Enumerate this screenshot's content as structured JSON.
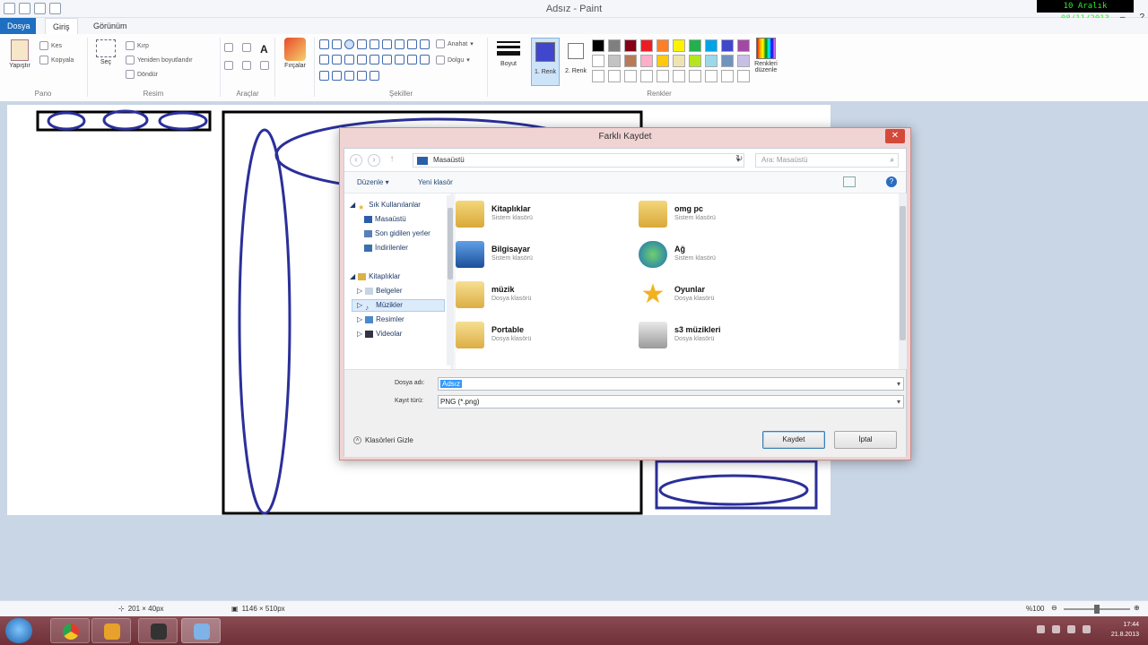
{
  "window": {
    "title": "Adsız - Paint",
    "overlay_datetime": "10 Aralık 08/11/2013"
  },
  "tabs": {
    "file": "Dosya",
    "home": "Giriş",
    "view": "Görünüm"
  },
  "ribbon": {
    "clipboard": {
      "paste": "Yapıştır",
      "cut": "Kes",
      "copy": "Kopyala",
      "label": "Pano"
    },
    "image": {
      "select": "Seç",
      "crop": "Kırp",
      "resize": "Yeniden boyutlandır",
      "rotate": "Döndür",
      "label": "Resim"
    },
    "tools": {
      "label": "Araçlar"
    },
    "brushes": {
      "label": "Fırçalar"
    },
    "shapes": {
      "outline": "Anahat",
      "fill": "Dolgu",
      "label": "Şekiller"
    },
    "size": {
      "label": "Boyut"
    },
    "color1": {
      "label": "1. Renk"
    },
    "color2": {
      "label": "2. Renk"
    },
    "colors": {
      "edit": "Renkleri düzenle",
      "label": "Renkler"
    }
  },
  "palette": [
    "#000000",
    "#7f7f7f",
    "#880015",
    "#ed1c24",
    "#ff7f27",
    "#fff200",
    "#22b14c",
    "#00a2e8",
    "#3f48cc",
    "#a349a4",
    "#ffffff",
    "#c3c3c3",
    "#b97a57",
    "#ffaec9",
    "#ffc90e",
    "#efe4b0",
    "#b5e61d",
    "#99d9ea",
    "#7092be",
    "#c8bfe7",
    "#ffffff",
    "#ffffff",
    "#ffffff",
    "#ffffff",
    "#ffffff",
    "#ffffff",
    "#ffffff",
    "#ffffff",
    "#ffffff",
    "#ffffff"
  ],
  "colors": {
    "color1": "#3f48cc",
    "color2": "#ffffff",
    "accent": "#1e6fc2"
  },
  "dialog": {
    "title": "Farklı Kaydet",
    "address": "Masaüstü",
    "search_placeholder": "Ara: Masaüstü",
    "toolbar": {
      "organize": "Düzenle ▾",
      "new_folder": "Yeni klasör"
    },
    "tree": {
      "favorites": "Sık Kullanılanlar",
      "desktop": "Masaüstü",
      "recent": "Son gidilen yerler",
      "downloads": "İndirilenler",
      "libraries": "Kitaplıklar",
      "documents": "Belgeler",
      "music": "Müzikler",
      "pictures": "Resimler",
      "videos": "Videolar"
    },
    "files": [
      {
        "name": "Kitaplıklar",
        "type": "Sistem klasörü",
        "icon": "libraries-icon"
      },
      {
        "name": "omg pc",
        "type": "Sistem klasörü",
        "icon": "user-folder-icon"
      },
      {
        "name": "Bilgisayar",
        "type": "Sistem klasörü",
        "icon": "computer-icon"
      },
      {
        "name": "Ağ",
        "type": "Sistem klasörü",
        "icon": "network-icon"
      },
      {
        "name": "müzik",
        "type": "Dosya klasörü",
        "icon": "folder-icon"
      },
      {
        "name": "Oyunlar",
        "type": "Dosya klasörü",
        "icon": "star-icon"
      },
      {
        "name": "Portable",
        "type": "Dosya klasörü",
        "icon": "folder-icon"
      },
      {
        "name": "s3 müzikleri",
        "type": "Dosya klasörü",
        "icon": "document-folder-icon"
      }
    ],
    "filename_label": "Dosya adı:",
    "filename_value": "Adsız",
    "filetype_label": "Kayıt türü:",
    "filetype_value": "PNG (*.png)",
    "hide_folders": "Klasörleri Gizle",
    "save_button": "Kaydet",
    "cancel_button": "İptal"
  },
  "status": {
    "cursor_pos": "201 × 40px",
    "canvas_size": "1146 × 510px",
    "zoom": "%100"
  },
  "taskbar": {
    "time": "17:44",
    "date": "21.8.2013"
  }
}
